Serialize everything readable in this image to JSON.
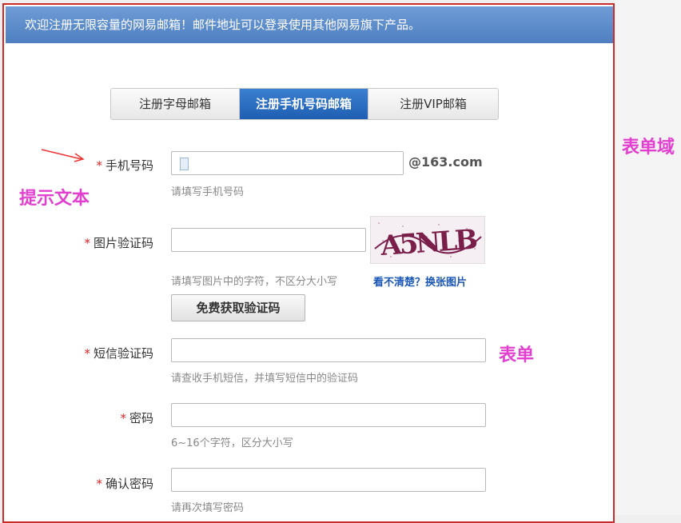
{
  "banner": {
    "text": "欢迎注册无限容量的网易邮箱！邮件地址可以登录使用其他网易旗下产品。"
  },
  "tabs": [
    {
      "label": "注册字母邮箱",
      "active": false
    },
    {
      "label": "注册手机号码邮箱",
      "active": true
    },
    {
      "label": "注册VIP邮箱",
      "active": false
    }
  ],
  "fields": {
    "phone": {
      "star": "*",
      "label": "手机号码",
      "value": "",
      "suffix": "@163.com",
      "hint": "请填写手机号码"
    },
    "image_code": {
      "star": "*",
      "label": "图片验证码",
      "value": "",
      "hint": "请填写图片中的字符，不区分大小写",
      "refresh_link": "看不清楚？换张图片",
      "captcha_text": "A5NLB"
    },
    "get_code_button": "免费获取验证码",
    "sms_code": {
      "star": "*",
      "label": "短信验证码",
      "value": "",
      "hint": "请查收手机短信，并填写短信中的验证码"
    },
    "password": {
      "star": "*",
      "label": "密码",
      "value": "",
      "hint": "6~16个字符，区分大小写"
    },
    "confirm_password": {
      "star": "*",
      "label": "确认密码",
      "value": "",
      "hint": "请再次填写密码"
    }
  },
  "annotations": {
    "prompt_text": "提示文本",
    "form_field": "表单域",
    "form": "表单"
  },
  "colors": {
    "frame_border": "#cc2b2b",
    "annotation": "#e23fd0",
    "active_tab": "#1f5fb3",
    "star": "#d22222"
  }
}
